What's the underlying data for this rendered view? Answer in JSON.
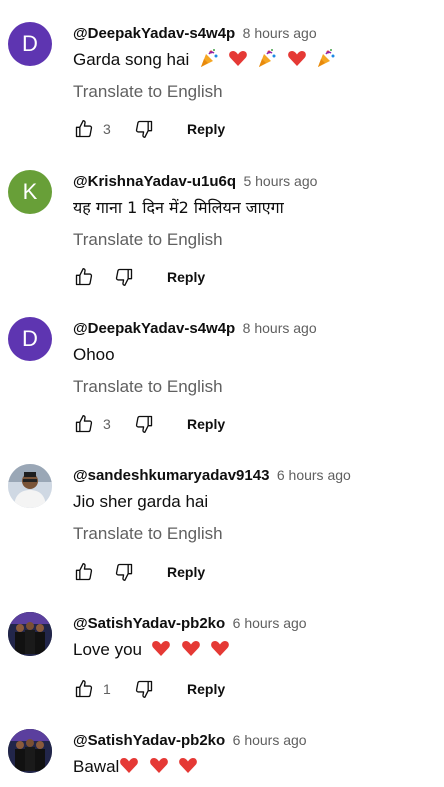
{
  "translate_label": "Translate to English",
  "reply_label": "Reply",
  "colors": {
    "avatar_purple": "#5e35b1",
    "avatar_green": "#689f38",
    "heart": "#e53935",
    "meta_gray": "#606060"
  },
  "comments": [
    {
      "author": "@DeepakYadav-s4w4p",
      "time": "8 hours ago",
      "avatar_letter": "D",
      "text": "Garda song hai",
      "emojis": [
        "party-popper",
        "heart",
        "party-popper",
        "heart",
        "party-popper"
      ],
      "translate": true,
      "likes": "3"
    },
    {
      "author": "@KrishnaYadav-u1u6q",
      "time": "5 hours ago",
      "avatar_letter": "K",
      "text": "यह गाना 1 दिन में2 मिलियन जाएगा",
      "emojis": [],
      "translate": true,
      "likes": ""
    },
    {
      "author": "@DeepakYadav-s4w4p",
      "time": "8 hours ago",
      "avatar_letter": "D",
      "text": "Ohoo",
      "emojis": [],
      "translate": true,
      "likes": "3"
    },
    {
      "author": "@sandeshkumaryadav9143",
      "time": "6 hours ago",
      "avatar_letter": "",
      "text": "Jio sher garda hai",
      "emojis": [],
      "translate": true,
      "likes": ""
    },
    {
      "author": "@SatishYadav-pb2ko",
      "time": "6 hours ago",
      "avatar_letter": "",
      "text": "Love you",
      "emojis": [
        "heart",
        "heart",
        "heart"
      ],
      "translate": false,
      "likes": "1"
    },
    {
      "author": "@SatishYadav-pb2ko",
      "time": "6 hours ago",
      "avatar_letter": "",
      "text": "Bawal",
      "emojis": [
        "heart",
        "heart",
        "heart"
      ],
      "translate": false,
      "likes": ""
    }
  ]
}
